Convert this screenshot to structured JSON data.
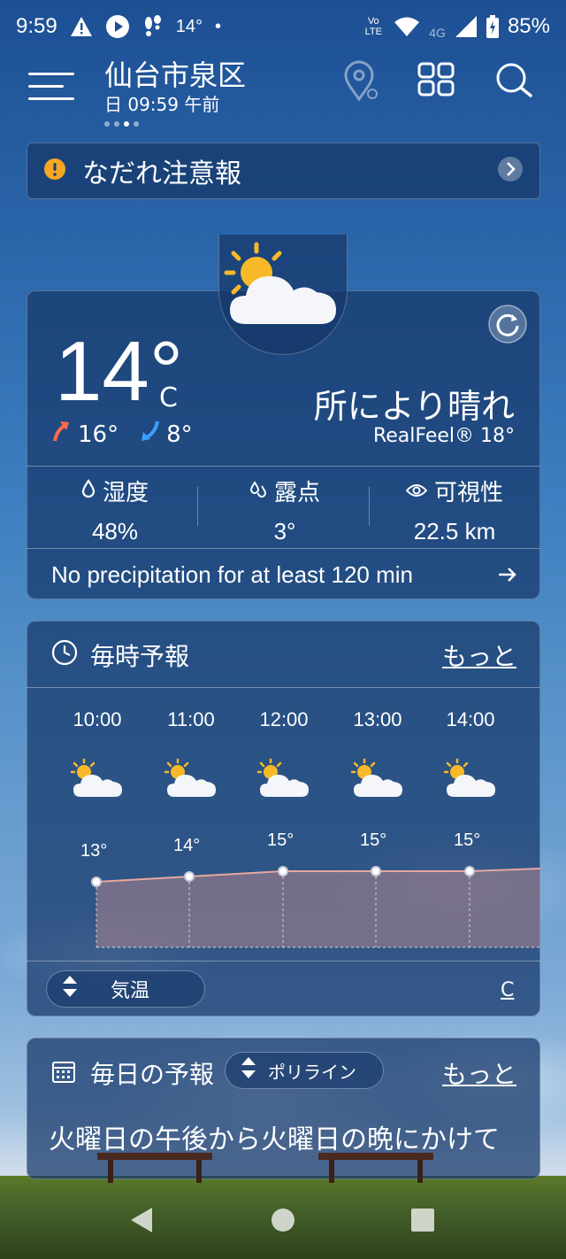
{
  "status_bar": {
    "time": "9:59",
    "notif_temp": "14°",
    "network": "4G",
    "volte": "Vo LTE",
    "battery": "85%"
  },
  "header": {
    "city": "仙台市泉区",
    "datetime": "日 09:59 午前"
  },
  "alert": {
    "text": "なだれ注意報"
  },
  "current": {
    "temp": "14°",
    "unit": "C",
    "high": "16°",
    "low": "8°",
    "condition": "所により晴れ",
    "realfeel": "RealFeel® 18°",
    "stats": [
      {
        "label": "湿度",
        "value": "48%"
      },
      {
        "label": "露点",
        "value": "3°"
      },
      {
        "label": "可視性",
        "value": "22.5 km"
      }
    ],
    "precip": "No precipitation for at least 120 min"
  },
  "hourly": {
    "title": "毎時予報",
    "more": "もっと",
    "hours": [
      {
        "time": "10:00",
        "temp": "13°",
        "value": 13
      },
      {
        "time": "11:00",
        "temp": "14°",
        "value": 14
      },
      {
        "time": "12:00",
        "temp": "15°",
        "value": 15
      },
      {
        "time": "13:00",
        "temp": "15°",
        "value": 15
      },
      {
        "time": "14:00",
        "temp": "15°",
        "value": 15
      }
    ],
    "selector": "気温",
    "unit": "C"
  },
  "daily": {
    "title": "毎日の予報",
    "selector": "ポリライン",
    "more": "もっと",
    "text": "火曜日の午後から火曜日の晩にかけて"
  },
  "colors": {
    "alert_icon": "#f5a623",
    "high_arrow": "#ff6a4d",
    "low_arrow": "#3aa0ff",
    "temp_fill": "#c98f8f"
  }
}
